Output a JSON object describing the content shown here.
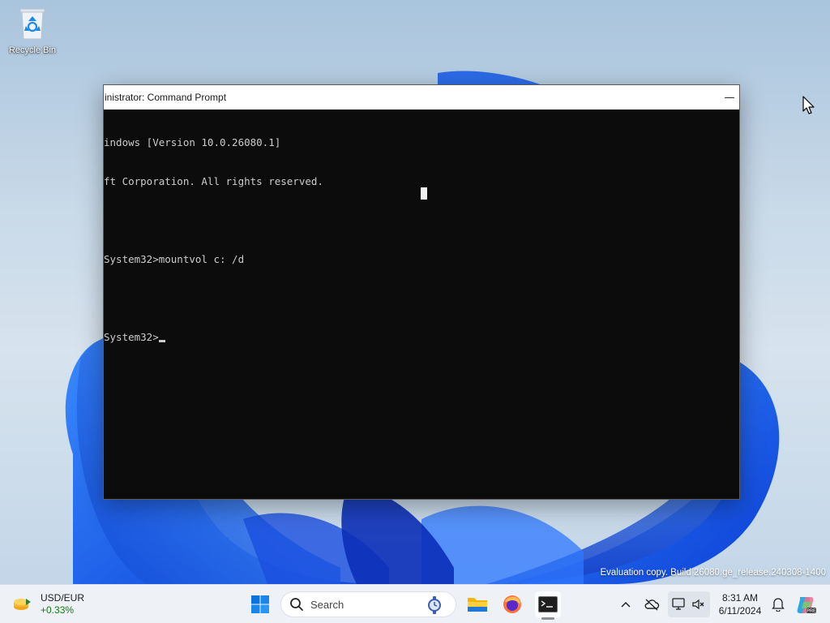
{
  "desktop": {
    "recycle_bin_label": "Recycle Bin",
    "watermark": "Evaluation copy. Build 26080.ge_release.240308-1400"
  },
  "cmd": {
    "title": "inistrator: Command Prompt",
    "minimize_glyph": "—",
    "lines": [
      "indows [Version 10.0.26080.1]",
      "ft Corporation. All rights reserved.",
      "",
      "System32>mountvol c: /d",
      "",
      "System32>"
    ],
    "background": "#0c0c0c",
    "foreground": "#cccccc"
  },
  "taskbar": {
    "widget": {
      "title": "USD/EUR",
      "change": "+0.33%",
      "icon": "currency-exchange-icon"
    },
    "search_placeholder": "Search",
    "apps": [
      {
        "name": "start",
        "icon": "windows-logo-icon"
      },
      {
        "name": "file-explorer",
        "icon": "folder-icon"
      },
      {
        "name": "firefox",
        "icon": "firefox-icon"
      },
      {
        "name": "terminal",
        "icon": "terminal-icon",
        "active": true
      }
    ],
    "tray": [
      "chevron-up-icon",
      "cloud-offline-icon",
      "network-icon",
      "volume-muted-icon"
    ],
    "clock": {
      "time": "8:31 AM",
      "date": "6/11/2024"
    },
    "accent": "#0067c0"
  }
}
